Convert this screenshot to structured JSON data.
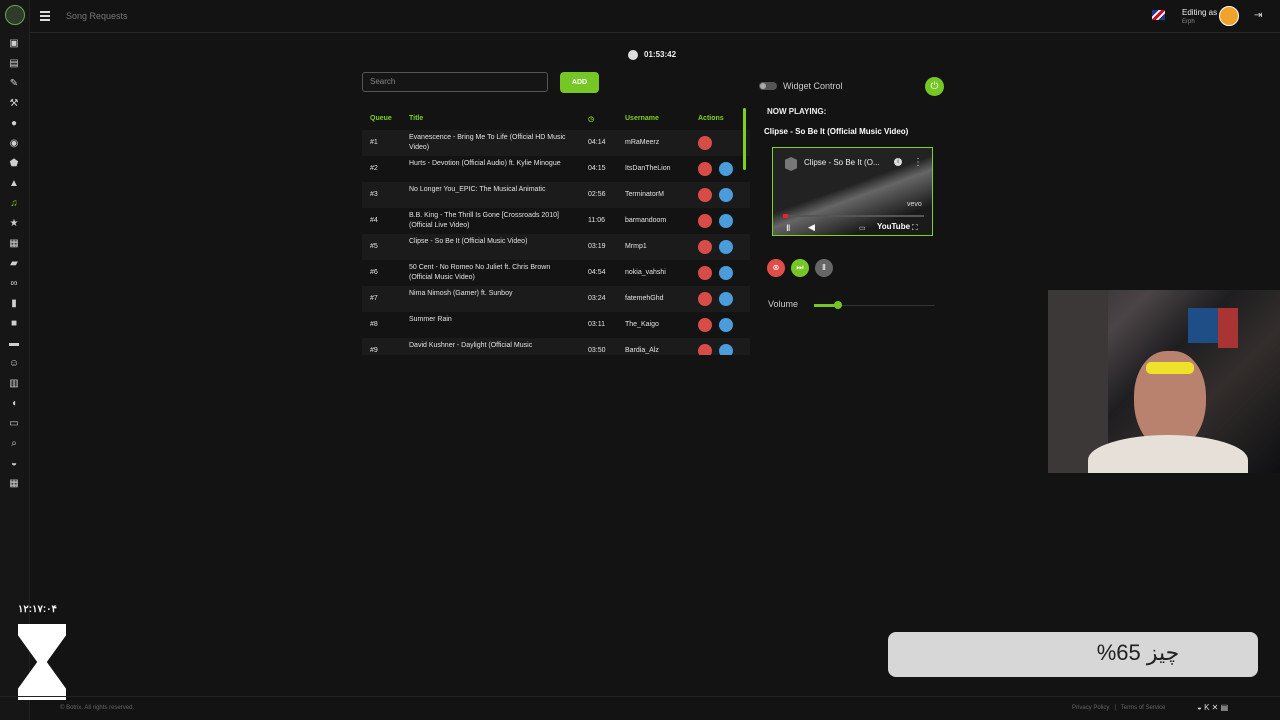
{
  "header": {
    "title": "Song Requests",
    "editing_label": "Editing as",
    "editing_user": "Erph"
  },
  "clock": {
    "time": "01:53:42"
  },
  "search": {
    "placeholder": "Search",
    "add_label": "ADD"
  },
  "queue": {
    "columns": [
      "Queue",
      "Title",
      "",
      "Username",
      "Actions"
    ],
    "rows": [
      {
        "queue": "#1",
        "title": "Evanescence - Bring Me To Life (Official HD Music Video)",
        "duration": "04:14",
        "username": "mRaMeerz"
      },
      {
        "queue": "#2",
        "title": "Hurts - Devotion (Official Audio) ft. Kylie Minogue",
        "duration": "04:15",
        "username": "ItsDanTheLion"
      },
      {
        "queue": "#3",
        "title": "No Longer You_EPIC: The Musical Animatic",
        "duration": "02:56",
        "username": "TerminatorM"
      },
      {
        "queue": "#4",
        "title": "B.B. King - The Thrill Is Gone [Crossroads 2010] (Official Live Video)",
        "duration": "11:06",
        "username": "barmandoom"
      },
      {
        "queue": "#5",
        "title": "Clipse - So Be It (Official Music Video)",
        "duration": "03:19",
        "username": "Mrmp1"
      },
      {
        "queue": "#6",
        "title": "50 Cent - No Romeo No Juliet ft. Chris Brown (Official Music Video)",
        "duration": "04:54",
        "username": "nokia_vahshi"
      },
      {
        "queue": "#7",
        "title": "Nima Nimosh (Gamer) ft. Sunboy",
        "duration": "03:24",
        "username": "fatemehGhd"
      },
      {
        "queue": "#8",
        "title": "Summer Rain",
        "duration": "03:11",
        "username": "The_Kaigo"
      },
      {
        "queue": "#9",
        "title": "David Kushner - Daylight (Official Music",
        "duration": "03:50",
        "username": "Bardia_Alz"
      }
    ]
  },
  "widget": {
    "label": "Widget Control",
    "now_playing": "NOW PLAYING:",
    "song": "Clipse - So Be It (Official Music Video)",
    "player_title": "Clipse - So Be It (O...",
    "vevo": "vevo",
    "youtube": "YouTube"
  },
  "volume": {
    "label": "Volume",
    "level": 0.2
  },
  "overlay": {
    "time": "۱۲:۱۷:۰۴",
    "progress_text": "چیز 65%",
    "progress": 0.65
  },
  "footer": {
    "copyright": "© Botrix. All rights reserved.",
    "privacy": "Privacy Policy",
    "terms": "Terms of Service"
  }
}
